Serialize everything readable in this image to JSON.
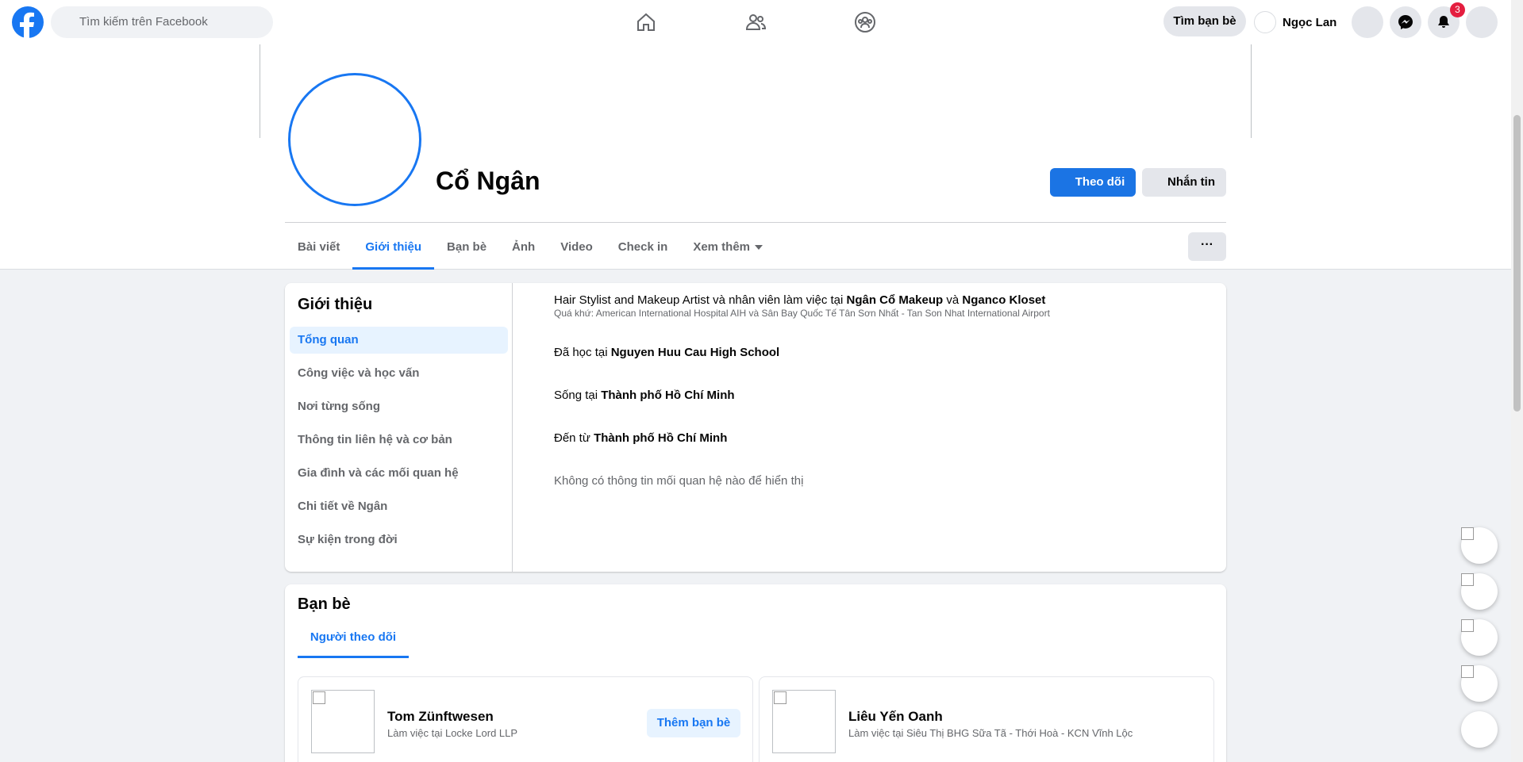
{
  "topbar": {
    "search_placeholder": "Tìm kiếm trên Facebook",
    "find_friends": "Tìm bạn bè",
    "user_name": "Ngọc Lan",
    "notification_count": "3"
  },
  "profile": {
    "name": "Cổ Ngân",
    "follow_label": "Theo dõi",
    "message_label": "Nhắn tin"
  },
  "tabs": [
    "Bài viết",
    "Giới thiệu",
    "Bạn bè",
    "Ảnh",
    "Video",
    "Check in",
    "Xem thêm"
  ],
  "more_label": "···",
  "about": {
    "title": "Giới thiệu",
    "sidebar": [
      "Tổng quan",
      "Công việc và học vấn",
      "Nơi từng sống",
      "Thông tin liên hệ và cơ bản",
      "Gia đình và các mối quan hệ",
      "Chi tiết về Ngân",
      "Sự kiện trong đời"
    ],
    "work": {
      "prefix": "Hair Stylist and Makeup Artist và nhân viên làm việc tại ",
      "employer1": "Ngân Cổ Makeup",
      "joiner": " và ",
      "employer2": "Nganco Kloset",
      "past": "Quá khứ: American International Hospital AIH và Sân Bay Quốc Tế Tân Sơn Nhất - Tan Son Nhat International Airport"
    },
    "education": {
      "prefix": "Đã học tại ",
      "school": "Nguyen Huu Cau High School"
    },
    "lives": {
      "prefix": "Sống tại ",
      "place": "Thành phố Hồ Chí Minh"
    },
    "from": {
      "prefix": "Đến từ ",
      "place": "Thành phố Hồ Chí Minh"
    },
    "relationship_empty": "Không có thông tin mối quan hệ nào để hiển thị"
  },
  "friends": {
    "title": "Bạn bè",
    "tab": "Người theo dõi",
    "items": [
      {
        "name": "Tom Zünftwesen",
        "sub": "Làm việc tại Locke Lord LLP",
        "action": "Thêm bạn bè"
      },
      {
        "name": "Liêu Yến Oanh",
        "sub": "Làm việc tại Siêu Thị BHG Sữa Tã - Thới Hoà - KCN Vĩnh Lộc"
      }
    ]
  },
  "colors": {
    "accent": "#1877f2",
    "badge": "#e41e3f",
    "bg": "#f0f2f5"
  },
  "icons": [
    "facebook-logo-icon",
    "search-icon",
    "home-icon",
    "friends-icon",
    "groups-icon",
    "menu-icon",
    "messenger-icon",
    "bell-icon",
    "account-icon"
  ]
}
